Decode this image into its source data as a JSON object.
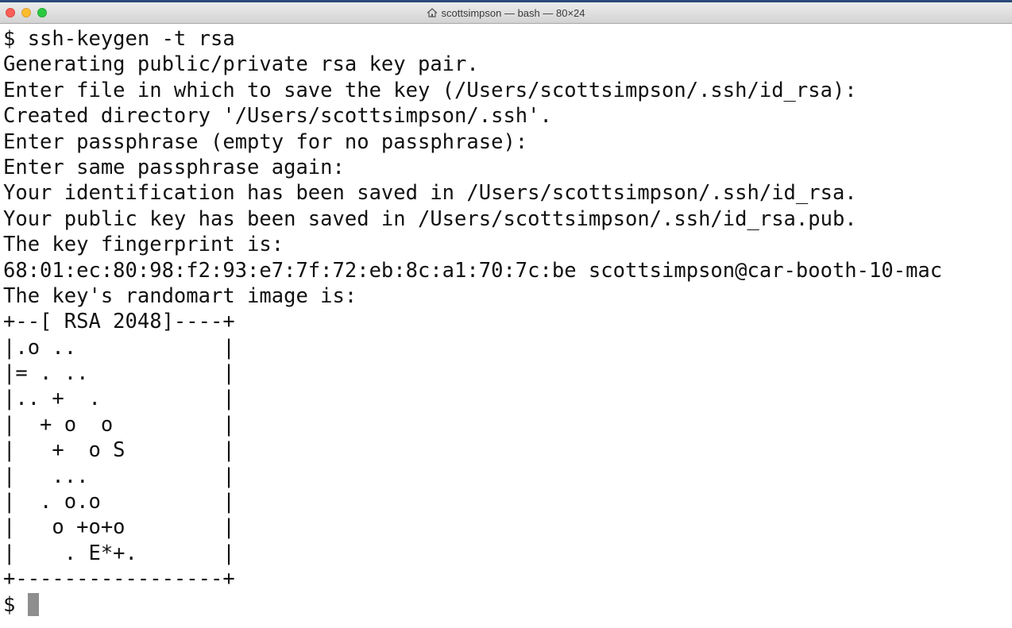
{
  "window": {
    "title": "scottsimpson — bash — 80×24",
    "title_icon": "home-icon"
  },
  "terminal": {
    "lines": [
      "$ ssh-keygen -t rsa",
      "Generating public/private rsa key pair.",
      "Enter file in which to save the key (/Users/scottsimpson/.ssh/id_rsa):",
      "Created directory '/Users/scottsimpson/.ssh'.",
      "Enter passphrase (empty for no passphrase):",
      "Enter same passphrase again:",
      "Your identification has been saved in /Users/scottsimpson/.ssh/id_rsa.",
      "Your public key has been saved in /Users/scottsimpson/.ssh/id_rsa.pub.",
      "The key fingerprint is:",
      "68:01:ec:80:98:f2:93:e7:7f:72:eb:8c:a1:70:7c:be scottsimpson@car-booth-10-mac",
      "The key's randomart image is:",
      "+--[ RSA 2048]----+",
      "|.o ..            |",
      "|= . ..           |",
      "|.. +  .          |",
      "|  + o  o         |",
      "|   +  o S        |",
      "|   ...           |",
      "|  . o.o          |",
      "|   o +o+o        |",
      "|    . E*+.       |",
      "+-----------------+"
    ],
    "prompt": "$ "
  },
  "colors": {
    "background": "#ffffff",
    "text": "#111111",
    "cursor": "#8e8e8e"
  }
}
